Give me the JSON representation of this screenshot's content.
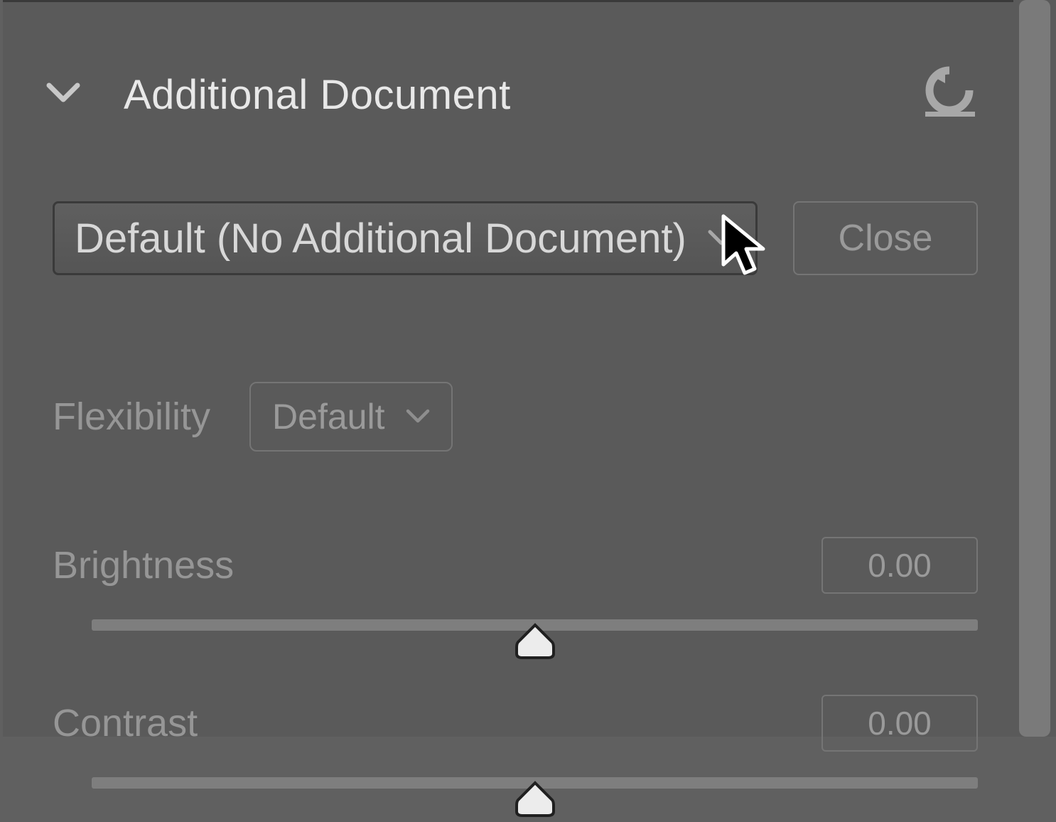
{
  "section": {
    "title": "Additional Document",
    "reset_icon": "reset-icon"
  },
  "document_select": {
    "selected": "Default (No Additional Document)",
    "close_label": "Close"
  },
  "flexibility": {
    "label": "Flexibility",
    "selected": "Default"
  },
  "sliders": {
    "brightness": {
      "label": "Brightness",
      "value": "0.00",
      "position_pct": 50
    },
    "contrast": {
      "label": "Contrast",
      "value": "0.00",
      "position_pct": 50
    }
  },
  "colors": {
    "text_primary": "#E8E8E8",
    "text_dim": "#969696",
    "border_light": "#757575",
    "border_dark": "#3A3A3A",
    "panel": "#5A5A5A"
  }
}
